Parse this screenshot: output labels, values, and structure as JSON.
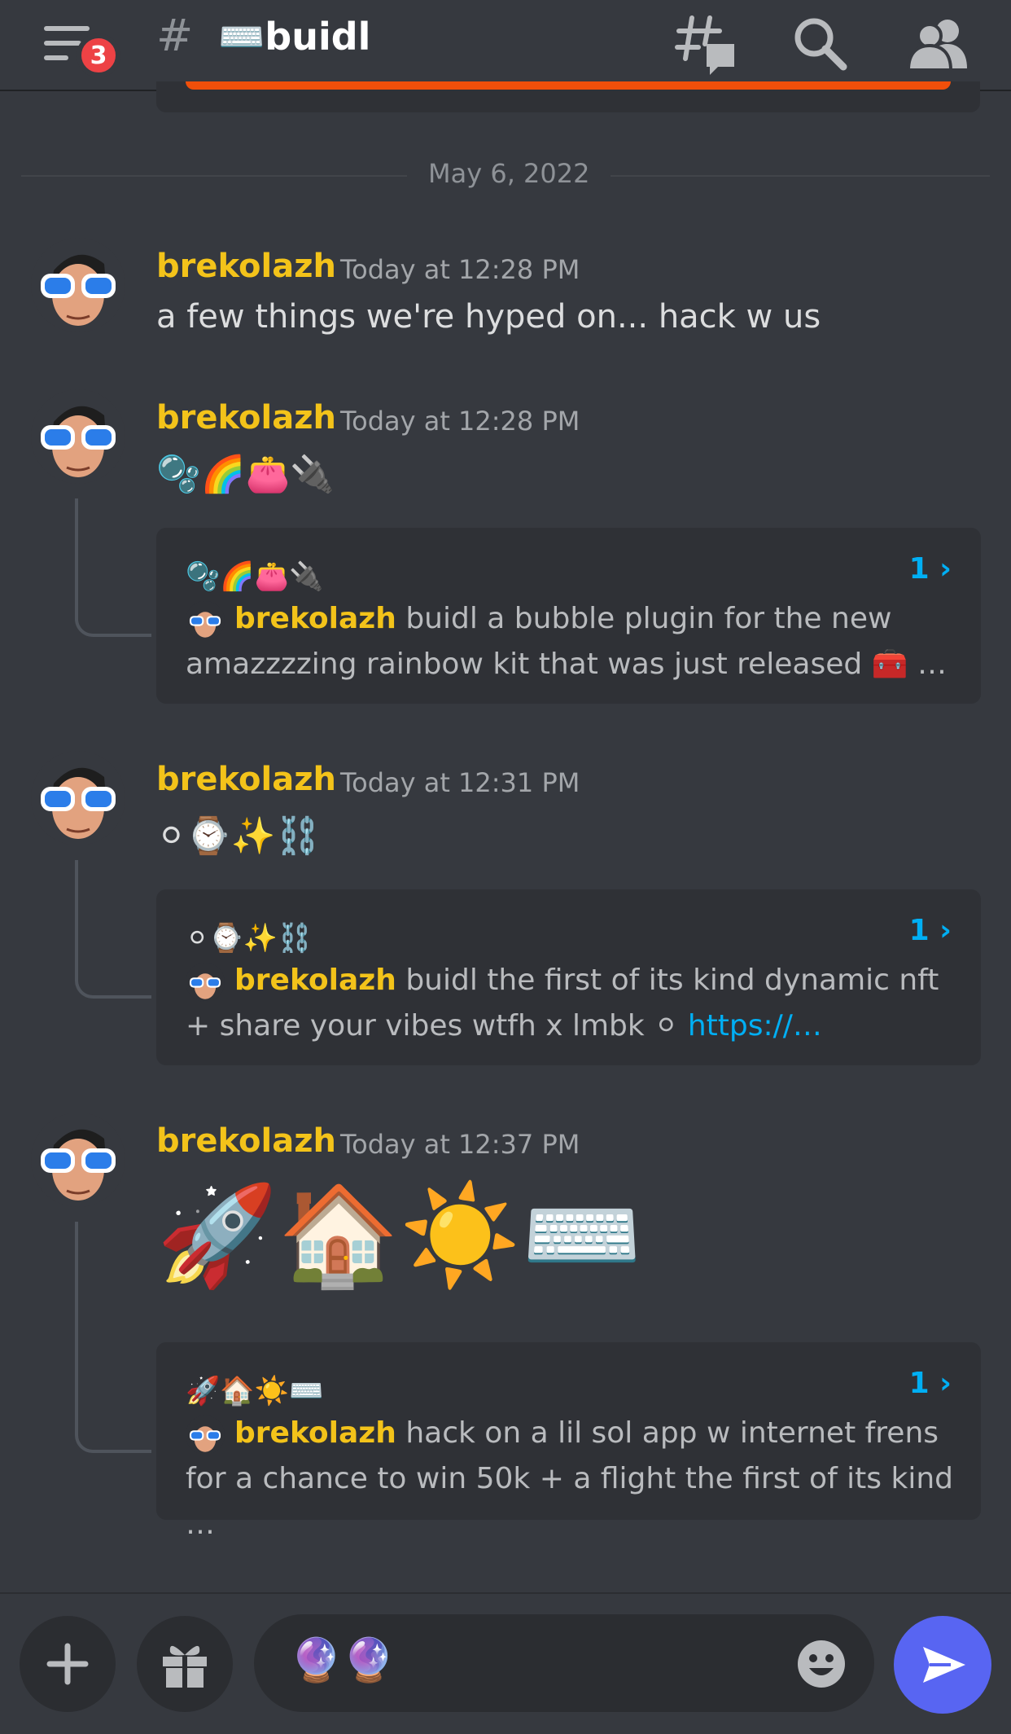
{
  "header": {
    "notification_count": "3",
    "hash_symbol": "#",
    "channel_name": "⌨️buidl",
    "icons": [
      "menu-icon",
      "threads-icon",
      "search-icon",
      "members-icon"
    ]
  },
  "date_divider": "May 6, 2022",
  "messages": [
    {
      "author": "brekolazh",
      "timestamp": "Today at 12:28 PM",
      "text": "a few things we're hyped on... hack w us"
    },
    {
      "author": "brekolazh",
      "timestamp": "Today at 12:28 PM",
      "text": "🫧🌈👛🔌",
      "thread": {
        "title": "🫧🌈👛🔌",
        "count": "1 ›",
        "author": "brekolazh",
        "preview": "buidl a bubble plugin for the new amazzzzing rainbow kit that was just released 🧰 …"
      }
    },
    {
      "author": "brekolazh",
      "timestamp": "Today at 12:31 PM",
      "text": "⚪⌚✨⛓️",
      "thread": {
        "title": "⚪⌚✨⛓️",
        "count": "1 ›",
        "author": "brekolazh",
        "preview": "buidl the first of its kind dynamic nft + share your vibes wtfh x lmbk ⚪ ",
        "link": "https://…"
      }
    },
    {
      "author": "brekolazh",
      "timestamp": "Today at 12:37 PM",
      "text": "🚀🏠☀️⌨️",
      "thread": {
        "title": "🚀🏠☀️⌨️",
        "count": "1 ›",
        "author": "brekolazh",
        "preview": "hack on a lil sol app w internet frens for a chance to win 50k + a flight the first of its kind …"
      }
    }
  ],
  "composer": {
    "value": "🔮🔮",
    "icons": [
      "plus-icon",
      "gift-icon",
      "emoji-icon",
      "send-icon"
    ]
  },
  "colors": {
    "background": "#36393f",
    "card": "#2f3136",
    "username": "#f3c31a",
    "link": "#00aff4",
    "send": "#5865f2",
    "badge": "#ed4245"
  }
}
